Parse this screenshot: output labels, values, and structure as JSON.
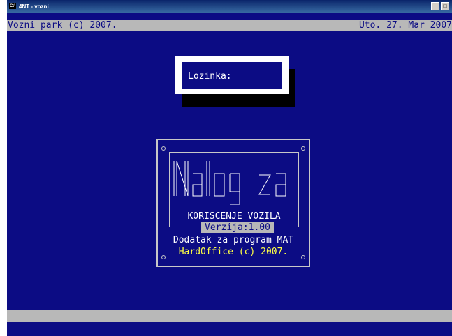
{
  "window": {
    "title": "4NT - vozni",
    "icon_text": "C:\\",
    "minimize_glyph": "_",
    "maximize_glyph": "□"
  },
  "statusbar": {
    "left": "Vozni park (c) 2007.",
    "right": "Uto. 27. Mar 2007"
  },
  "password": {
    "label": "Lozinka:"
  },
  "splash": {
    "logo_text": "Nalog za",
    "subtitle": "KORISCENJE  VOZILA",
    "version": "Verzija:1.00",
    "line1": "Dodatak za program MAT",
    "line2": "HardOffice (c) 2007."
  },
  "colors": {
    "background": "#0c0c84",
    "bar": "#b8b8b8",
    "highlight": "#ffff44"
  }
}
